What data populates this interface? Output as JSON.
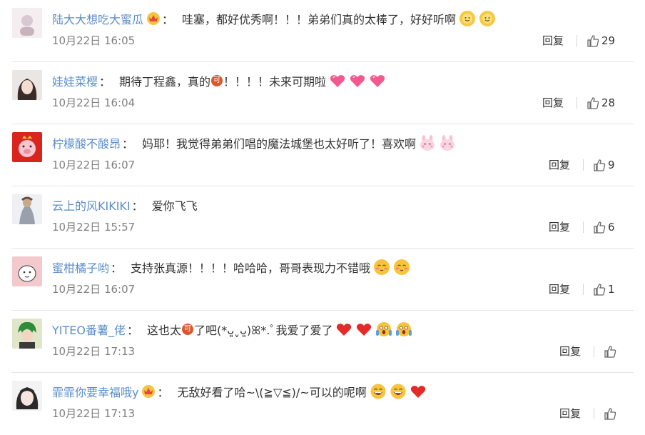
{
  "comments": [
    {
      "user": "陆大大想吃大蜜瓜",
      "badge": "crown",
      "text": "哇塞，都好优秀啊！！！弟弟们真的太棒了，好好听啊",
      "emojis": [
        "sun-face",
        "sun-face"
      ],
      "time": "10月22日 16:05",
      "reply": "回复",
      "likes": "29"
    },
    {
      "user": "娃娃菜樱",
      "badge": "",
      "text_a": "期待丁程鑫，真的",
      "ke": "可",
      "text_b": "！！！！未来可期啦",
      "emojis": [
        "heart-pink",
        "heart-pink",
        "heart-pink"
      ],
      "time": "10月22日 16:04",
      "reply": "回复",
      "likes": "28"
    },
    {
      "user": "柠檬酸不酸昂",
      "badge": "",
      "text": "妈耶！我觉得弟弟们唱的魔法城堡也太好听了！喜欢啊",
      "emojis": [
        "bunny",
        "bunny"
      ],
      "time": "10月22日 16:07",
      "reply": "回复",
      "likes": "9"
    },
    {
      "user": "云上的风KIKIKI",
      "badge": "",
      "text": "爱你飞飞",
      "emojis": [],
      "time": "10月22日 15:57",
      "reply": "回复",
      "likes": "6"
    },
    {
      "user": "蜜柑橘子哟",
      "badge": "",
      "text": "支持张真源！！！！哈哈哈，哥哥表现力不错哦",
      "emojis": [
        "shy-face",
        "shy-face"
      ],
      "time": "10月22日 16:07",
      "reply": "回复",
      "likes": "1"
    },
    {
      "user": "YITEO番薯_佬",
      "badge": "",
      "text_a": "这也太",
      "ke": "可",
      "text_b": "了吧(*ᴗ͈ˬᴗ͈)ꕤ*.ﾟ我爱了爱了",
      "emojis": [
        "heart-red",
        "heart-red",
        "scream",
        "scream"
      ],
      "time": "10月22日 17:13",
      "reply": "回复",
      "likes": ""
    },
    {
      "user": "霏霏你要幸福哦y",
      "badge": "crown",
      "text": "无敌好看了哈~\\(≧▽≦)/~可以的呢啊",
      "emojis": [
        "grin",
        "grin",
        "heart-red"
      ],
      "time": "10月22日 17:13",
      "reply": "回复",
      "likes": ""
    }
  ],
  "colors": {
    "username": "#5c8ec8",
    "text": "#333333",
    "meta": "#808080"
  }
}
